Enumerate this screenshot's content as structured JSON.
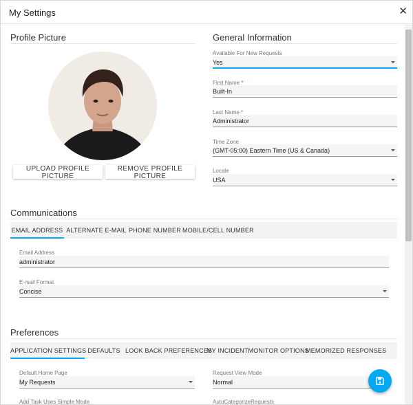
{
  "dialog": {
    "title": "My Settings",
    "close_icon": "close-icon"
  },
  "profile_picture": {
    "title": "Profile Picture",
    "upload_label": "UPLOAD PROFILE PICTURE",
    "remove_label": "REMOVE PROFILE PICTURE"
  },
  "general_information": {
    "title": "General Information",
    "available": {
      "label": "Available For New Requests",
      "value": "Yes"
    },
    "first_name": {
      "label": "First Name",
      "required_mark": "*",
      "value": "Built-In"
    },
    "last_name": {
      "label": "Last Name",
      "required_mark": "*",
      "value": "Administrator"
    },
    "time_zone": {
      "label": "Time Zone",
      "value": "(GMT-05:00) Eastern Time (US & Canada)"
    },
    "locale": {
      "label": "Locale",
      "value": "USA"
    }
  },
  "communications": {
    "title": "Communications",
    "tabs": [
      "EMAIL ADDRESS",
      "ALTERNATE E-MAIL",
      "PHONE NUMBER",
      "MOBILE/CELL NUMBER"
    ],
    "active_tab": 0,
    "email_address": {
      "label": "Email Address",
      "value": "administrator"
    },
    "email_format": {
      "label": "E-mail Format",
      "value": "Concise"
    }
  },
  "preferences": {
    "title": "Preferences",
    "tabs": [
      "APPLICATION SETTINGS",
      "DEFAULTS",
      "LOOK BACK PREFERENCES",
      "MY INCIDENTMONITOR OPTIONS",
      "MEMORIZED RESPONSES"
    ],
    "active_tab": 0,
    "default_home_page": {
      "label": "Default Home Page",
      "value": "My Requests"
    },
    "request_view_mode": {
      "label": "Request View Mode",
      "value": "Normal"
    },
    "add_task_simple_mode": {
      "label": "Add Task Uses Simple Mode"
    },
    "autocategorize": {
      "label": "AutoCategorizeRequests"
    }
  },
  "colors": {
    "accent": "#03a9f4",
    "required": "#e53935",
    "field_bg": "#f5f5f5",
    "tab_bar_bg": "#f3f3f3"
  },
  "icons": {
    "save": "save-icon",
    "dropdown": "caret-down-icon"
  }
}
